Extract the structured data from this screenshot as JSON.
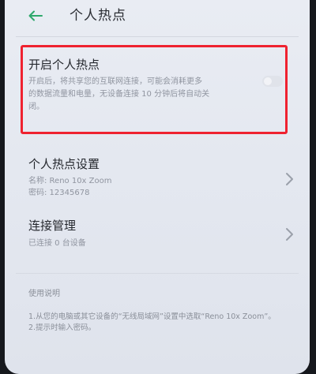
{
  "header": {
    "title": "个人热点",
    "back_icon": "arrow-left-icon",
    "accent_color": "#2ea86b"
  },
  "hotspot_toggle": {
    "title": "开启个人热点",
    "description_line1": "开启后，将共享您的互联网连接，可能会消耗更多",
    "description_line2": "的数据流量和电量，无设备连接 10 分钟后将自动关",
    "description_line3": "闭。",
    "enabled": false,
    "highlight_color": "#ef2230"
  },
  "hotspot_settings": {
    "title": "个人热点设置",
    "name_line": "名称: Reno 10x Zoom",
    "password_line": "密码: 12345678"
  },
  "connection_management": {
    "title": "连接管理",
    "status": "已连接 0 台设备"
  },
  "help": {
    "title": "使用说明",
    "line1": "1.从您的电脑或其它设备的“无线局域网”设置中选取“Reno 10x Zoom”。",
    "line2": "2.提示时输入密码。"
  }
}
